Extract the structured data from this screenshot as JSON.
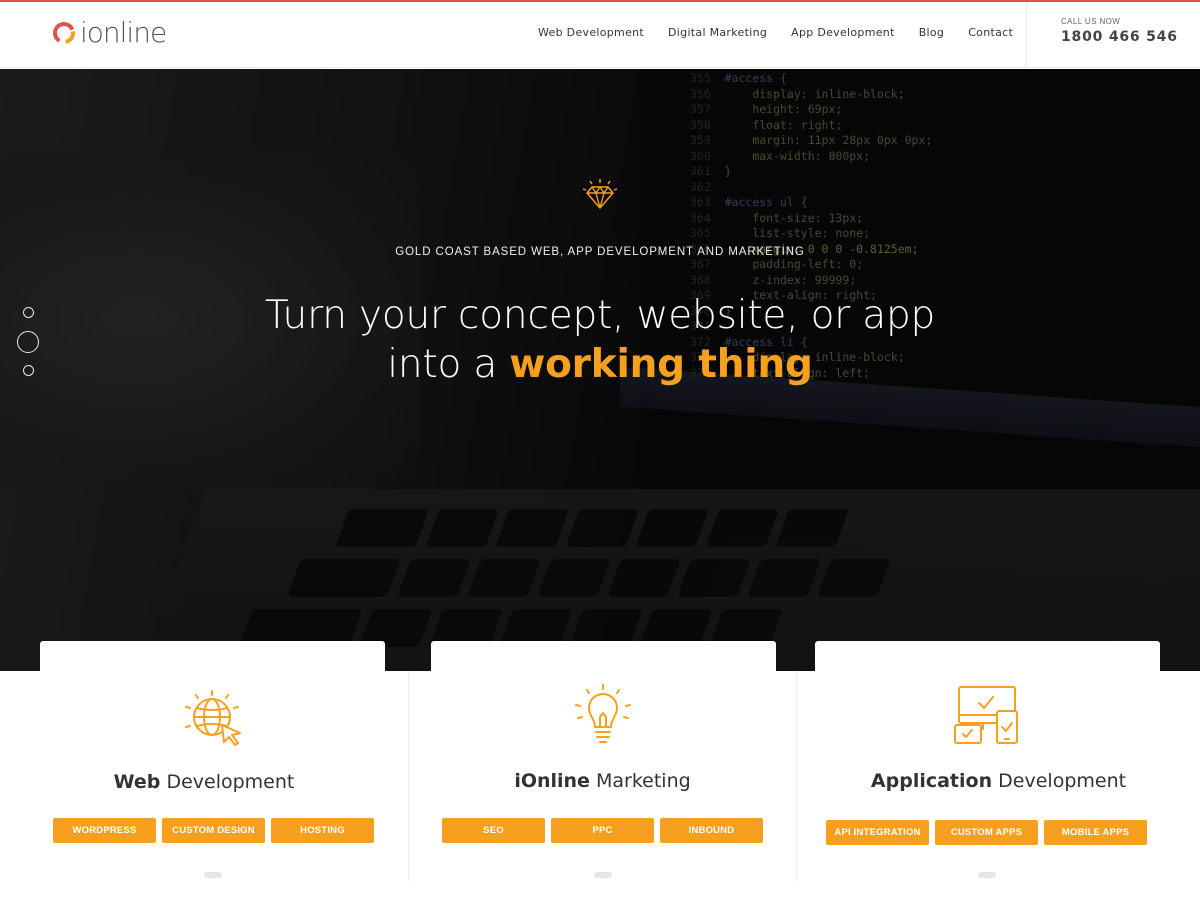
{
  "brand": {
    "name": "ionline",
    "top_line_color": "#e0524a",
    "accent": "#f7a020"
  },
  "nav": {
    "items": [
      {
        "label": "Web Development"
      },
      {
        "label": "Digital Marketing"
      },
      {
        "label": "App Development"
      },
      {
        "label": "Blog"
      },
      {
        "label": "Contact"
      }
    ]
  },
  "call": {
    "label": "CALL US NOW",
    "number": "1800 466 546"
  },
  "hero": {
    "tagline": "GOLD COAST BASED WEB, APP DEVELOPMENT AND MARKETING",
    "headline_line1": "Turn your concept, website, or app",
    "headline_line2_prefix": "into a ",
    "headline_line2_accent": "working thing",
    "slider_dots": 3,
    "active_dot": 2,
    "icon": "diamond-icon"
  },
  "background_code": [
    {
      "ln": "355",
      "text": "#access {",
      "cls": "c1"
    },
    {
      "ln": "356",
      "text": "    display: inline-block;",
      "cls": "c2"
    },
    {
      "ln": "357",
      "text": "    height: 69px;",
      "cls": "c2"
    },
    {
      "ln": "358",
      "text": "    float: right;",
      "cls": "c2"
    },
    {
      "ln": "359",
      "text": "    margin: 11px 28px 0px 0px;",
      "cls": "c2"
    },
    {
      "ln": "360",
      "text": "    max-width: 800px;",
      "cls": "c2"
    },
    {
      "ln": "361",
      "text": "}",
      "cls": "c2"
    },
    {
      "ln": "362",
      "text": "",
      "cls": "c2"
    },
    {
      "ln": "363",
      "text": "#access ul {",
      "cls": "c1"
    },
    {
      "ln": "364",
      "text": "    font-size: 13px;",
      "cls": "c2"
    },
    {
      "ln": "365",
      "text": "    list-style: none;",
      "cls": "c2"
    },
    {
      "ln": "366",
      "text": "    margin: 0 0 0 -0.8125em;",
      "cls": "c3"
    },
    {
      "ln": "367",
      "text": "    padding-left: 0;",
      "cls": "c2"
    },
    {
      "ln": "368",
      "text": "    z-index: 99999;",
      "cls": "c2"
    },
    {
      "ln": "369",
      "text": "    text-align: right;",
      "cls": "c2"
    },
    {
      "ln": "370",
      "text": "}",
      "cls": "c2"
    },
    {
      "ln": "371",
      "text": "",
      "cls": "c2"
    },
    {
      "ln": "372",
      "text": "#access li {",
      "cls": "c1"
    },
    {
      "ln": "373",
      "text": "    display: inline-block;",
      "cls": "c2"
    },
    {
      "ln": "374",
      "text": "    text-align: left;",
      "cls": "c2"
    }
  ],
  "cards": [
    {
      "title_bold": "Web",
      "title_rest": " Development",
      "icon": "globe-cursor-icon",
      "tags": [
        "WORDPRESS",
        "CUSTOM DESIGN",
        "HOSTING"
      ]
    },
    {
      "title_bold": "iOnline",
      "title_rest": " Marketing",
      "icon": "lightbulb-icon",
      "tags": [
        "SEO",
        "PPC",
        "INBOUND"
      ]
    },
    {
      "title_bold": "Application",
      "title_rest": " Development",
      "icon": "devices-icon",
      "tags": [
        "API INTEGRATION",
        "CUSTOM APPS",
        "MOBILE APPS"
      ]
    }
  ]
}
